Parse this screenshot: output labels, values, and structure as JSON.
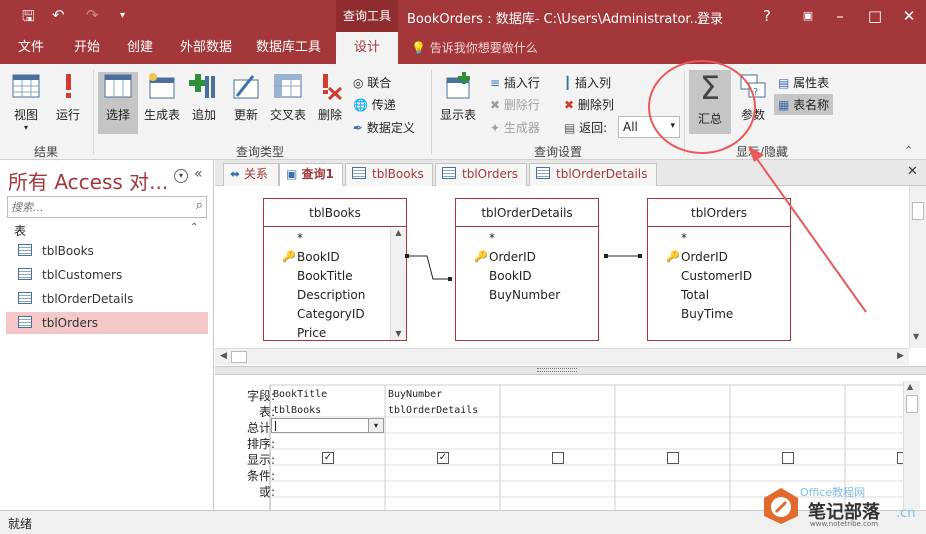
{
  "title_bar": {
    "context_tab": "查询工具",
    "window_title": "BookOrders : 数据库- C:\\Users\\Administrator...",
    "login": "登录",
    "help": "?"
  },
  "ribbon_tabs": [
    {
      "label": "文件"
    },
    {
      "label": "开始"
    },
    {
      "label": "创建"
    },
    {
      "label": "外部数据"
    },
    {
      "label": "数据库工具"
    },
    {
      "label": "设计",
      "active": true
    }
  ],
  "tell_me": "告诉我你想要做什么",
  "ribbon": {
    "results": {
      "label": "结果",
      "view": "视图",
      "run": "运行"
    },
    "query_type": {
      "label": "查询类型",
      "select": "选择",
      "make_table": "生成表",
      "append": "追加",
      "update": "更新",
      "crosstab": "交叉表",
      "delete": "删除",
      "union": "联合",
      "pass_through": "传递",
      "data_definition": "数据定义"
    },
    "query_setup": {
      "label": "查询设置",
      "show_table": "显示表",
      "insert_rows": "插入行",
      "delete_rows": "删除行",
      "builder": "生成器",
      "insert_columns": "插入列",
      "delete_columns": "删除列",
      "return_label": "返回:",
      "return_value": "All"
    },
    "show_hide": {
      "label": "显示/隐藏",
      "totals": "汇总",
      "parameters": "参数",
      "property_sheet": "属性表",
      "table_names": "表名称"
    }
  },
  "nav": {
    "title": "所有 Access 对...",
    "search_placeholder": "搜索...",
    "section": "表",
    "items": [
      "tblBooks",
      "tblCustomers",
      "tblOrderDetails",
      "tblOrders"
    ]
  },
  "doc_tabs": [
    "关系",
    "查询1",
    "tblBooks",
    "tblOrders",
    "tblOrderDetails"
  ],
  "tables": [
    {
      "name": "tblBooks",
      "fields": [
        "*",
        "BookID",
        "BookTitle",
        "Description",
        "CategoryID",
        "Price"
      ]
    },
    {
      "name": "tblOrderDetails",
      "fields": [
        "*",
        "OrderID",
        "BookID",
        "BuyNumber"
      ]
    },
    {
      "name": "tblOrders",
      "fields": [
        "*",
        "OrderID",
        "CustomerID",
        "Total",
        "BuyTime"
      ]
    }
  ],
  "grid": {
    "row_labels": [
      "字段:",
      "表:",
      "总计:",
      "排序:",
      "显示:",
      "条件:",
      "或:"
    ],
    "columns": [
      {
        "field": "BookTitle",
        "table": "tblBooks",
        "show": true
      },
      {
        "field": "BuyNumber",
        "table": "tblOrderDetails",
        "show": true
      },
      {
        "field": "",
        "table": "",
        "show": false
      },
      {
        "field": "",
        "table": "",
        "show": false
      },
      {
        "field": "",
        "table": "",
        "show": false
      }
    ]
  },
  "status": "就绪",
  "watermark": {
    "text": "笔记部落",
    "url": "www.notetribe.com",
    "brand": "Office教程网",
    "domain": ".cn"
  },
  "colors": {
    "brand": "#a4373a",
    "annotation": "#e85a5a"
  }
}
